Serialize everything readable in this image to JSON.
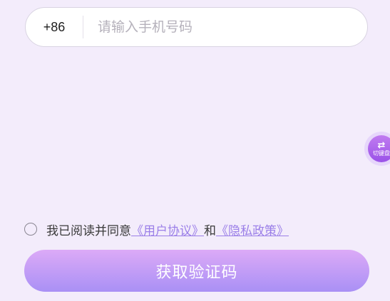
{
  "login": {
    "country_code": "+86",
    "phone_placeholder": "请输入手机号码",
    "agree_prefix": "我已阅读并同意",
    "user_agreement": "《用户协议》",
    "and_text": "和",
    "privacy_policy": "《隐私政策》",
    "submit_label": "获取验证码"
  },
  "floating": {
    "switch_keyboard_icon": "⇄",
    "switch_keyboard_label": "切键盘"
  },
  "colors": {
    "background": "#f3ecfb",
    "accent": "#9b7fe8",
    "button_top": "#dcaaf7",
    "button_bottom": "#a990f5"
  }
}
